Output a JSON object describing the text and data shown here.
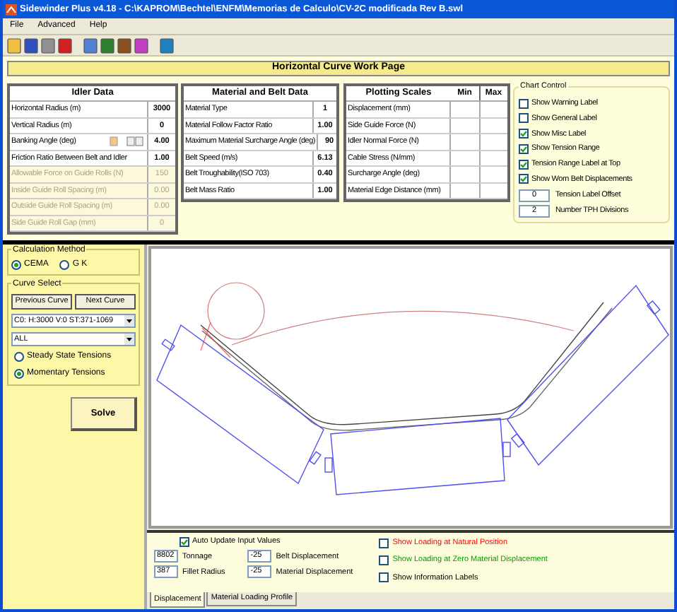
{
  "window": {
    "title": "Sidewinder Plus v4.18 - C:\\KAPROM\\Bechtel\\ENFM\\Memorias de Calculo\\CV-2C modificada Rev B.swl"
  },
  "menu": [
    "File",
    "Advanced",
    "Help"
  ],
  "page_title": "Horizontal Curve Work Page",
  "idler_data": {
    "heading": "Idler Data",
    "rows": [
      {
        "label": "Horizontal Radius (m)",
        "value": "3000",
        "disabled": false,
        "kind": "plain"
      },
      {
        "label": "Vertical Radius (m)",
        "value": "0",
        "disabled": false,
        "kind": "plain"
      },
      {
        "label": "Banking Angle (deg)",
        "value": "4.00",
        "disabled": false,
        "kind": "spinner"
      },
      {
        "label": "Friction Ratio Between Belt and Idler",
        "value": "1.00",
        "disabled": false,
        "kind": "plain"
      },
      {
        "label": "Allowable Force on Guide Rolls (N)",
        "value": "150",
        "disabled": true,
        "kind": "plain"
      },
      {
        "label": "Inside Guide Roll Spacing (m)",
        "value": "0.00",
        "disabled": true,
        "kind": "plain"
      },
      {
        "label": "Outside Guide Roll Spacing (m)",
        "value": "0.00",
        "disabled": true,
        "kind": "plain"
      },
      {
        "label": "Side Guide Roll Gap (mm)",
        "value": "0",
        "disabled": true,
        "kind": "plain"
      }
    ]
  },
  "material_belt_data": {
    "heading": "Material and Belt Data",
    "rows": [
      {
        "label": "Material Type",
        "value": "1"
      },
      {
        "label": "Material Follow Factor Ratio",
        "value": "1.00"
      },
      {
        "label": "Maximum Material Surcharge Angle (deg)",
        "value": "90"
      },
      {
        "label": "Belt Speed (m/s)",
        "value": "6.13"
      },
      {
        "label": "Belt Troughability(ISO 703)",
        "value": "0.40"
      },
      {
        "label": "Belt Mass Ratio",
        "value": "1.00"
      }
    ]
  },
  "plotting_scales": {
    "heading": "Plotting Scales",
    "columns": [
      "Min",
      "Max"
    ],
    "rows": [
      "Displacement (mm)",
      "Side Guide Force (N)",
      "Idler Normal Force (N)",
      "Cable Stress (N/mm)",
      "Surcharge Angle (deg)",
      "Material Edge Distance (mm)"
    ]
  },
  "chart_control": {
    "title": "Chart Control",
    "checkboxes": [
      {
        "label": "Show Warning Label",
        "checked": false
      },
      {
        "label": "Show General Label",
        "checked": false
      },
      {
        "label": "Show Misc Label",
        "checked": true
      },
      {
        "label": "Show Tension Range",
        "checked": true
      },
      {
        "label": "Tension Range Label at Top",
        "checked": true
      },
      {
        "label": "Show Worn Belt Displacements",
        "checked": true
      }
    ],
    "fields": [
      {
        "value": "0",
        "label": "Tension Label Offset"
      },
      {
        "value": "2",
        "label": "Number TPH Divisions"
      }
    ]
  },
  "calculation_method": {
    "title": "Calculation Method",
    "options": [
      {
        "label": "CEMA",
        "selected": true
      },
      {
        "label": "G K",
        "selected": false
      }
    ]
  },
  "curve_select": {
    "title": "Curve Select",
    "buttons": [
      "Previous Curve",
      "Next Curve"
    ],
    "dropdowns": [
      "C0: H:3000 V:0 ST:371-1069",
      "ALL"
    ],
    "options": [
      {
        "label": "Steady State Tensions",
        "selected": false
      },
      {
        "label": "Momentary Tensions",
        "selected": true
      }
    ]
  },
  "solve": "Solve",
  "bottom": {
    "auto_update": {
      "label": "Auto Update Input Values",
      "checked": true
    },
    "fields": [
      {
        "value": "8802",
        "label": "Tonnage"
      },
      {
        "value": "-25",
        "label": "Belt Displacement"
      },
      {
        "value": "387",
        "label": "Fillet Radius"
      },
      {
        "value": "-25",
        "label": "Material Displacement"
      }
    ],
    "toggles": [
      {
        "label": "Show Loading at Natural Position",
        "checked": false,
        "color": "#ff0000"
      },
      {
        "label": "Show Loading at Zero Material Displacement",
        "checked": false,
        "color": "#00a000"
      },
      {
        "label": "Show Information Labels",
        "checked": false,
        "color": "#000000"
      }
    ]
  },
  "tabs": [
    {
      "label": "Displacement",
      "selected": true
    },
    {
      "label": "Material Loading Profile",
      "selected": false
    }
  ]
}
